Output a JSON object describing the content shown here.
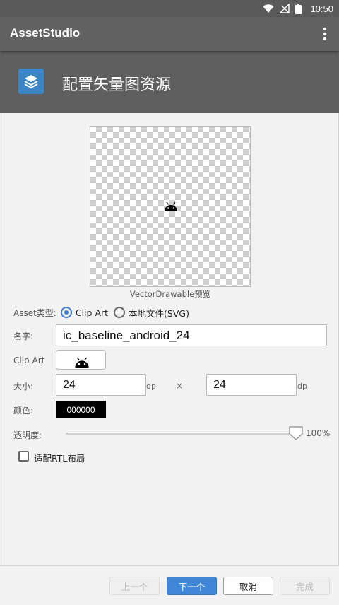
{
  "status_bar": {
    "time": "10:50",
    "icons": [
      "wifi-icon",
      "no-signal-icon",
      "battery-icon"
    ]
  },
  "toolbar": {
    "title": "AssetStudio",
    "menu_icon": "more-vert-icon"
  },
  "header": {
    "title": "配置矢量图资源",
    "icon": "layers-icon",
    "icon_color": "#3d86c6"
  },
  "preview": {
    "caption": "VectorDrawable预览",
    "icon": "android-icon"
  },
  "asset_type": {
    "label": "Asset类型:",
    "options": [
      {
        "label": "Clip Art",
        "selected": true
      },
      {
        "label": "本地文件(SVG)",
        "selected": false
      }
    ]
  },
  "name": {
    "label": "名字:",
    "value": "ic_baseline_android_24"
  },
  "clip_art": {
    "label": "Clip Art",
    "icon": "android-icon"
  },
  "size": {
    "label": "大小:",
    "width": "24",
    "height": "24",
    "unit": "dp",
    "separator": "×"
  },
  "color": {
    "label": "颜色:",
    "value": "000000",
    "swatch": "#000000"
  },
  "opacity": {
    "label": "透明度:",
    "value_text": "100%",
    "percent": 100
  },
  "rtl": {
    "label": "适配RTL布局",
    "checked": false
  },
  "buttons": {
    "prev": "上一个",
    "next": "下一个",
    "cancel": "取消",
    "finish": "完成"
  },
  "colors": {
    "accent": "#3f86d6",
    "toolbar": "#616161",
    "header": "#5f5f5f"
  }
}
